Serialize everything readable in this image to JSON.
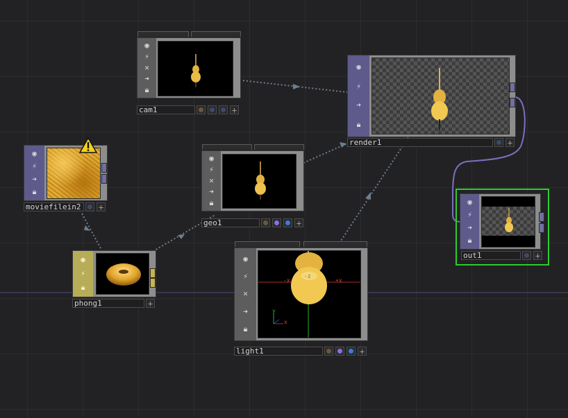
{
  "nodes": {
    "cam1": {
      "name": "cam1"
    },
    "render1": {
      "name": "render1"
    },
    "moviefilein2": {
      "name": "moviefilein2"
    },
    "geo1": {
      "name": "geo1"
    },
    "out1": {
      "name": "out1"
    },
    "phong1": {
      "name": "phong1"
    },
    "light1": {
      "name": "light1"
    }
  },
  "light_viewer": {
    "neg_x": "-x",
    "pos_x": "+x",
    "neg_z": "-z",
    "axis_y": "y",
    "axis_x": "x"
  },
  "colors": {
    "background": "#222224",
    "comp_side": "#5f5a8c",
    "mat_side": "#b8ad57",
    "selected_border": "#2ecc2e",
    "wire_dotted": "#6d7f8f",
    "wire_solid": "#7d6fc0",
    "flag_blue": "#3a7be0",
    "flag_purple": "#8a6fe0",
    "flag_brown": "#6b5838"
  },
  "icons": [
    "viewer-icon",
    "bypass-icon",
    "close-icon",
    "arrow-icon",
    "lock-icon",
    "warning-icon",
    "plus-icon"
  ]
}
